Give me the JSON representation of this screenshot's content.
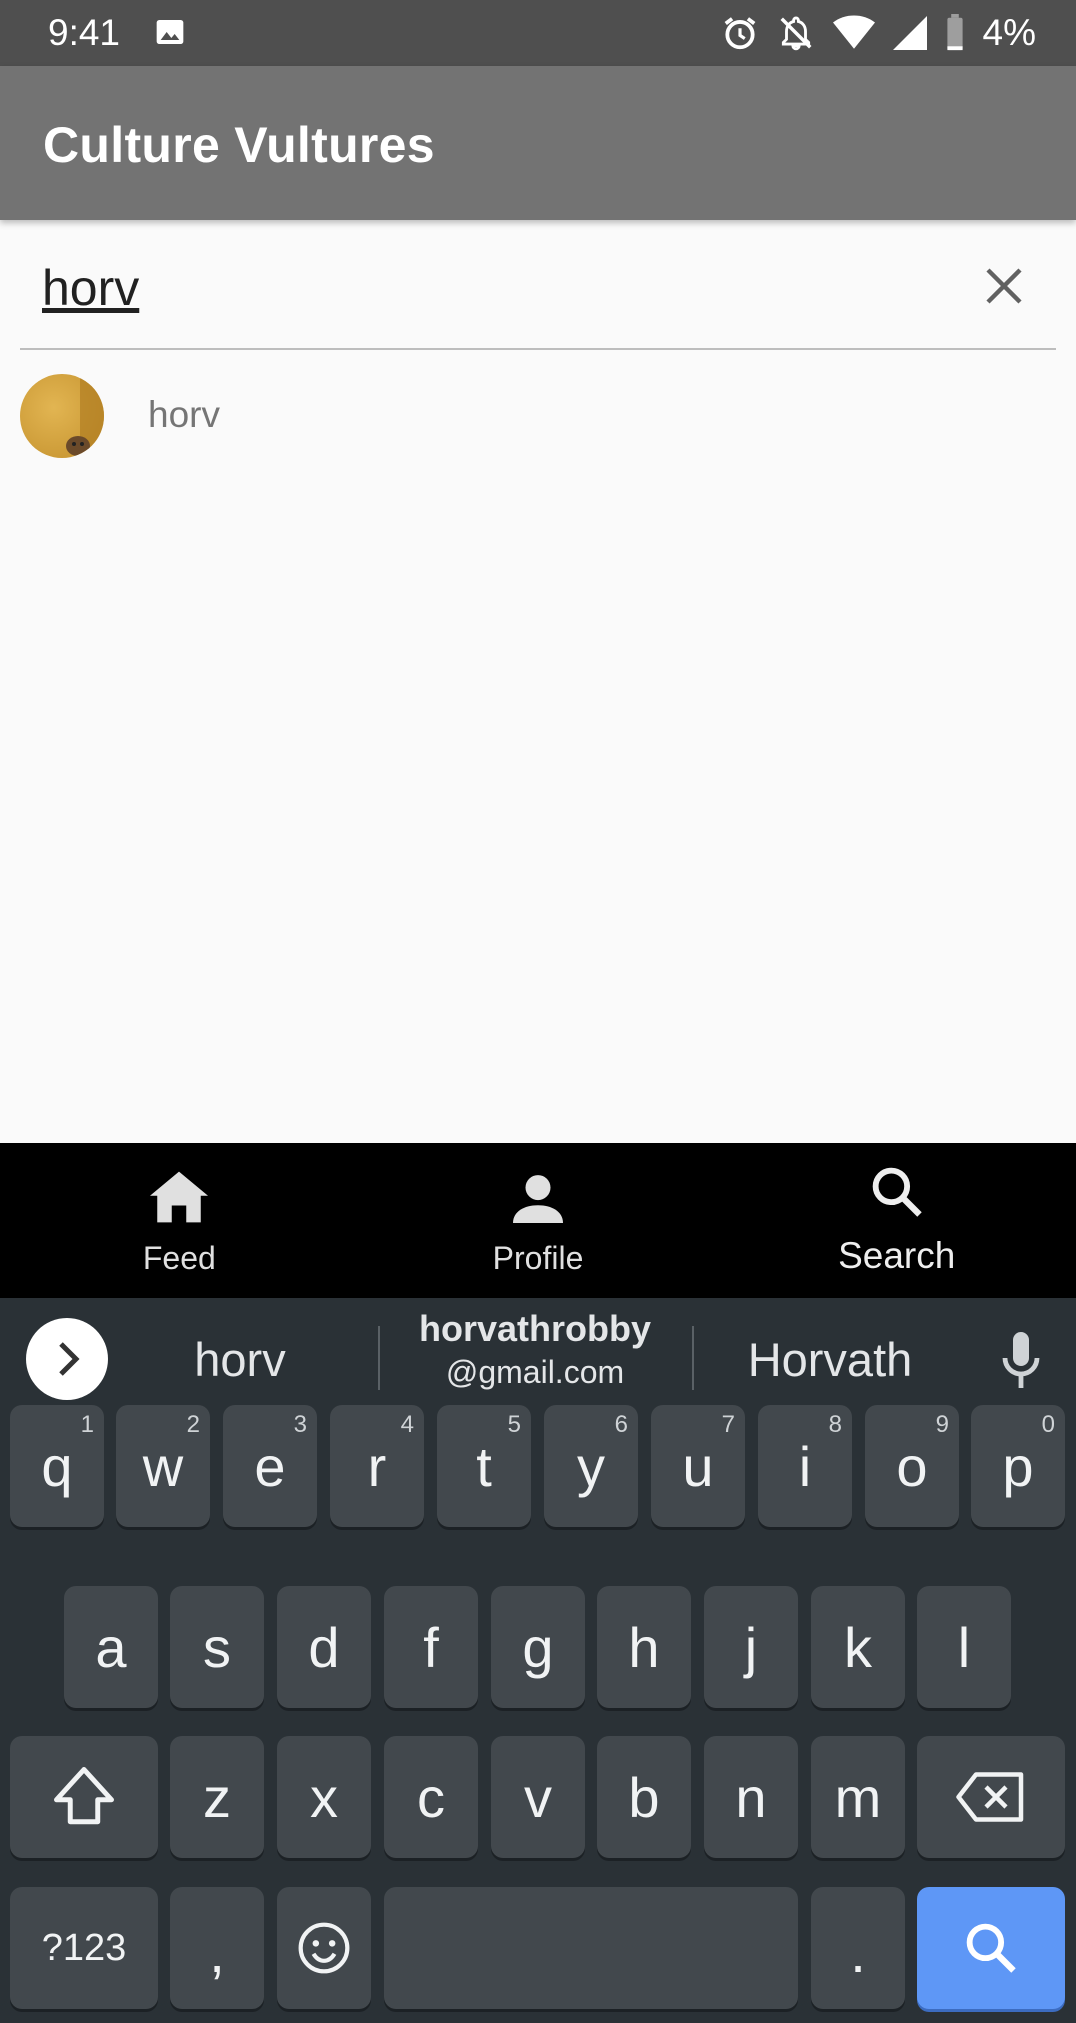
{
  "status_bar": {
    "time": "9:41",
    "battery": "4%",
    "icons": [
      "photo-icon",
      "alarm-icon",
      "notifications-off-icon",
      "wifi-icon",
      "signal-icon",
      "battery-icon"
    ]
  },
  "app_bar": {
    "title": "Culture Vultures",
    "color": "#737373"
  },
  "search": {
    "value": "horv",
    "placeholder": ""
  },
  "results": [
    {
      "name": "horv",
      "avatar_color": "#d4a23c"
    }
  ],
  "bottom_nav": {
    "items": [
      {
        "label": "Feed",
        "icon": "home-icon"
      },
      {
        "label": "Profile",
        "icon": "person-icon"
      },
      {
        "label": "Search",
        "icon": "search-icon"
      }
    ]
  },
  "keyboard": {
    "suggestions": {
      "first": "horv",
      "middle_line1": "horvathrobby",
      "middle_line2": "@gmail.com",
      "last": "Horvath"
    },
    "row1": [
      {
        "key": "q",
        "hint": "1"
      },
      {
        "key": "w",
        "hint": "2"
      },
      {
        "key": "e",
        "hint": "3"
      },
      {
        "key": "r",
        "hint": "4"
      },
      {
        "key": "t",
        "hint": "5"
      },
      {
        "key": "y",
        "hint": "6"
      },
      {
        "key": "u",
        "hint": "7"
      },
      {
        "key": "i",
        "hint": "8"
      },
      {
        "key": "o",
        "hint": "9"
      },
      {
        "key": "p",
        "hint": "0"
      }
    ],
    "row2": [
      "a",
      "s",
      "d",
      "f",
      "g",
      "h",
      "j",
      "k",
      "l"
    ],
    "row3": [
      "z",
      "x",
      "c",
      "v",
      "b",
      "n",
      "m"
    ],
    "symbols_key": "?123",
    "comma_key": ",",
    "period_key": ".",
    "accent_color": "#5e97f6"
  }
}
